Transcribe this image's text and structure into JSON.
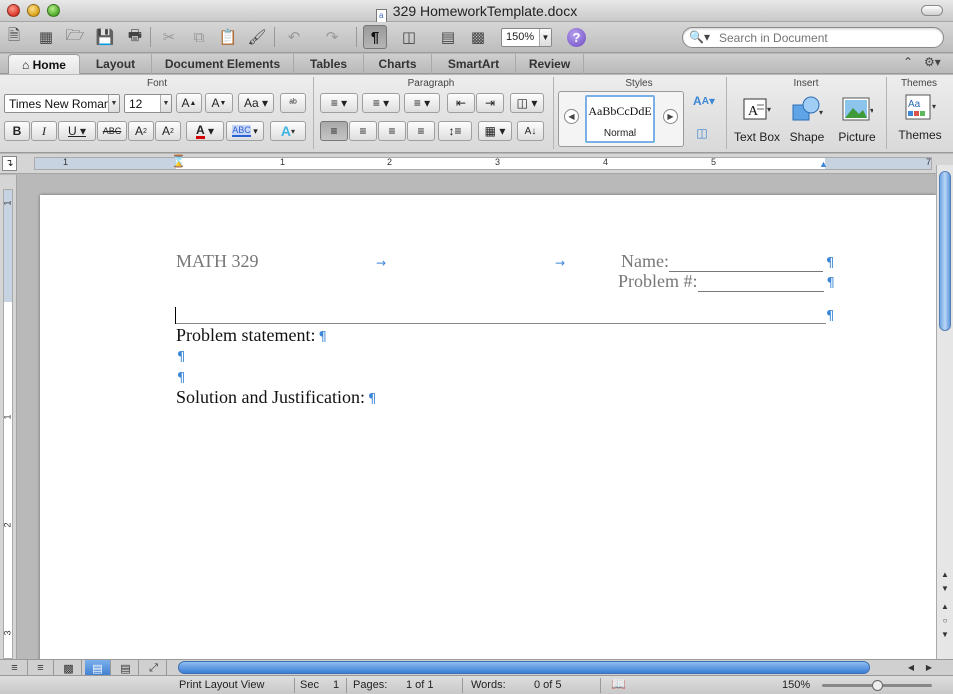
{
  "window": {
    "title": "329 HomeworkTemplate.docx"
  },
  "toolbar": {
    "zoom_value": "150%",
    "search_placeholder": "Search in Document"
  },
  "ribbon_tabs": [
    {
      "label": "Home",
      "active": true
    },
    {
      "label": "Layout"
    },
    {
      "label": "Document Elements"
    },
    {
      "label": "Tables"
    },
    {
      "label": "Charts"
    },
    {
      "label": "SmartArt"
    },
    {
      "label": "Review"
    }
  ],
  "ribbon": {
    "groups": {
      "font": "Font",
      "paragraph": "Paragraph",
      "styles": "Styles",
      "insert": "Insert",
      "themes": "Themes"
    },
    "font_name": "Times New Roman",
    "font_size": "12",
    "style_sample": "AaBbCcDdE",
    "style_name": "Normal",
    "insert_buttons": {
      "text_box": "Text Box",
      "shape": "Shape",
      "picture": "Picture"
    },
    "themes_button": "Themes",
    "font_color": "#d40000",
    "highlight_color": "#2b5fd6"
  },
  "ruler": {
    "h_numbers": [
      "1",
      "1",
      "2",
      "3",
      "4",
      "5",
      "7"
    ],
    "v_numbers": [
      "1",
      "1",
      "2",
      "3"
    ]
  },
  "document": {
    "course": "MATH 329",
    "name_label": "Name:",
    "problem_label": "Problem #:",
    "problem_statement": "Problem statement:",
    "solution": "Solution and Justification:",
    "pilcrow": "¶",
    "tab_mark": "→"
  },
  "statusbar": {
    "view": "Print Layout View",
    "sec_label": "Sec",
    "sec_value": "1",
    "pages_label": "Pages:",
    "pages_value": "1 of 1",
    "words_label": "Words:",
    "words_value": "0 of 5",
    "zoom": "150%"
  },
  "accent": "#3b86d6"
}
